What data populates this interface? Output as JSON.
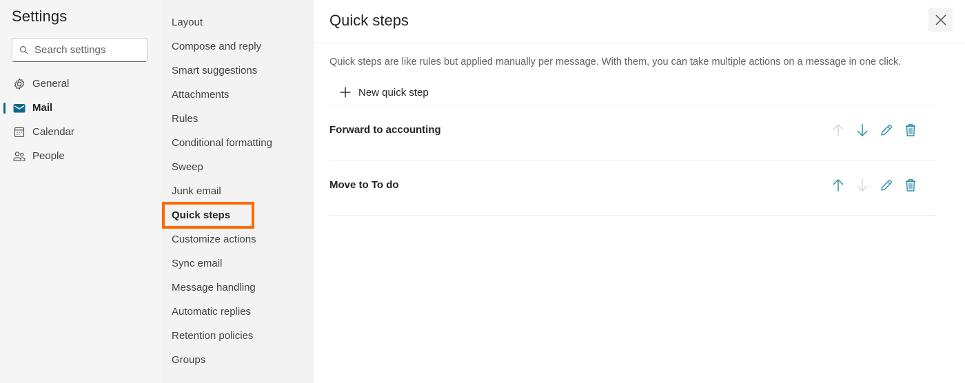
{
  "sidebar": {
    "title": "Settings",
    "search": {
      "placeholder": "Search settings",
      "value": ""
    },
    "items": [
      {
        "label": "General",
        "icon": "gear-icon",
        "selected": false
      },
      {
        "label": "Mail",
        "icon": "mail-icon",
        "selected": true
      },
      {
        "label": "Calendar",
        "icon": "calendar-icon",
        "selected": false
      },
      {
        "label": "People",
        "icon": "people-icon",
        "selected": false
      }
    ]
  },
  "submenu": {
    "items": [
      {
        "label": "Layout"
      },
      {
        "label": "Compose and reply"
      },
      {
        "label": "Smart suggestions"
      },
      {
        "label": "Attachments"
      },
      {
        "label": "Rules"
      },
      {
        "label": "Conditional formatting"
      },
      {
        "label": "Sweep"
      },
      {
        "label": "Junk email"
      },
      {
        "label": "Quick steps",
        "selected": true
      },
      {
        "label": "Customize actions"
      },
      {
        "label": "Sync email"
      },
      {
        "label": "Message handling"
      },
      {
        "label": "Automatic replies"
      },
      {
        "label": "Retention policies"
      },
      {
        "label": "Groups"
      }
    ]
  },
  "panel": {
    "title": "Quick steps",
    "close_icon": "close-icon",
    "description": "Quick steps are like rules but applied manually per message. With them, you can take multiple actions on a message in one click.",
    "new_button_label": "New quick step",
    "steps": [
      {
        "name": "Forward to accounting",
        "move_up_enabled": false,
        "move_down_enabled": true
      },
      {
        "name": "Move to To do",
        "move_up_enabled": true,
        "move_down_enabled": false
      }
    ]
  },
  "colors": {
    "accent": "#0f6a8b",
    "action_icon": "#2b8fa6",
    "action_icon_disabled": "#d6d6d6",
    "highlight": "#ff6a00"
  }
}
